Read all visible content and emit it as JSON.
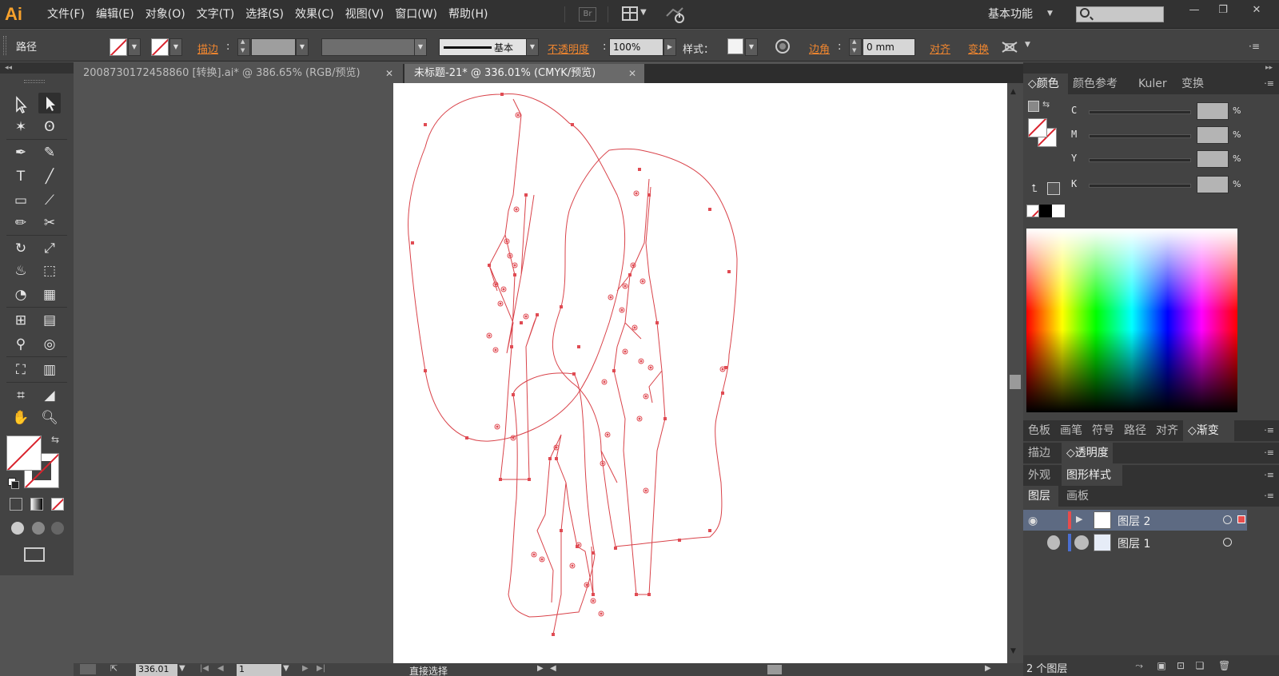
{
  "app": {
    "logo": "Ai"
  },
  "menu": [
    "文件(F)",
    "编辑(E)",
    "对象(O)",
    "文字(T)",
    "选择(S)",
    "效果(C)",
    "视图(V)",
    "窗口(W)",
    "帮助(H)"
  ],
  "menubar": {
    "bridge_label": "Br",
    "workspace": "基本功能",
    "search_placeholder": ""
  },
  "window_controls": {
    "minimize": "—",
    "restore": "❐",
    "close": "✕"
  },
  "control": {
    "object_type": "路径",
    "stroke_link": "描边",
    "stroke_style_label": "基本",
    "opacity_link": "不透明度",
    "opacity_value": "100%",
    "style_label": "样式：",
    "corner_link": "边角",
    "corner_value": "0 mm",
    "align_link": "对齐",
    "transform_link": "变换"
  },
  "tabs": [
    {
      "label": "2008730172458860 [转换].ai* @ 386.65% (RGB/预览)",
      "active": false
    },
    {
      "label": "未标题-21* @ 336.01% (CMYK/预览)",
      "active": true
    }
  ],
  "status": {
    "zoom": "336.01",
    "page": "1",
    "current_tool": "直接选择"
  },
  "color_panel": {
    "tabs": [
      "颜色",
      "颜色参考",
      "Kuler",
      "变换"
    ],
    "channels": [
      {
        "name": "C",
        "value": ""
      },
      {
        "name": "M",
        "value": ""
      },
      {
        "name": "Y",
        "value": ""
      },
      {
        "name": "K",
        "value": ""
      }
    ],
    "percent_sign": "%"
  },
  "panels_row2": [
    "色板",
    "画笔",
    "符号",
    "路径",
    "对齐",
    "渐变"
  ],
  "panels_row3": [
    "描边",
    "透明度"
  ],
  "panels_row4": [
    "外观",
    "图形样式"
  ],
  "layers_panel": {
    "tabs": [
      "图层",
      "画板"
    ],
    "layers": [
      {
        "name": "图层 2",
        "color": "#e84c4c",
        "selected": true
      },
      {
        "name": "图层 1",
        "color": "#4a6fd1",
        "selected": false
      }
    ],
    "count_label": "2 个图层"
  },
  "colors": {
    "path_stroke": "#d9434a",
    "accent_orange": "#f0862f",
    "ui_dark": "#323232",
    "ui_mid": "#434343",
    "canvas": "#535353"
  }
}
